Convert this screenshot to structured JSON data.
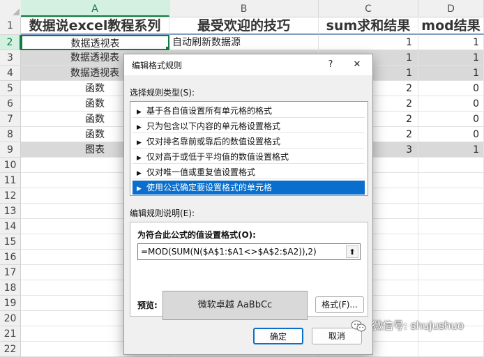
{
  "sheet": {
    "columns": [
      "A",
      "B",
      "C",
      "D"
    ],
    "row_numbers": [
      "1",
      "2",
      "3",
      "4",
      "5",
      "6",
      "7",
      "8",
      "9",
      "10",
      "11",
      "12",
      "13",
      "14",
      "15",
      "16",
      "17",
      "18",
      "19",
      "20",
      "21",
      "22"
    ],
    "header": {
      "a": "数据说excel教程系列",
      "b": "最受欢迎的技巧",
      "c": "sum求和结果",
      "d": "mod结果"
    },
    "rows": [
      {
        "a": "数据透视表",
        "b": "自动刷新数据源",
        "c": "1",
        "d": "1"
      },
      {
        "a": "数据透视表",
        "b": "",
        "c": "1",
        "d": "1"
      },
      {
        "a": "数据透视表",
        "b": "",
        "c": "1",
        "d": "1"
      },
      {
        "a": "函数",
        "b": "",
        "c": "2",
        "d": "0"
      },
      {
        "a": "函数",
        "b": "",
        "c": "2",
        "d": "0"
      },
      {
        "a": "函数",
        "b": "",
        "c": "2",
        "d": "0"
      },
      {
        "a": "函数",
        "b": "",
        "c": "2",
        "d": "0"
      },
      {
        "a": "图表",
        "b": "",
        "c": "3",
        "d": "1"
      }
    ]
  },
  "dialog": {
    "title": "编辑格式规则",
    "help_label": "?",
    "close_label": "✕",
    "rule_type_label": "选择规则类型(S):",
    "rule_types": [
      "基于各自值设置所有单元格的格式",
      "只为包含以下内容的单元格设置格式",
      "仅对排名靠前或靠后的数值设置格式",
      "仅对高于或低于平均值的数值设置格式",
      "仅对唯一值或重复值设置格式",
      "使用公式确定要设置格式的单元格"
    ],
    "selected_rule_index": 5,
    "edit_desc_label": "编辑规则说明(E):",
    "formula_label": "为符合此公式的值设置格式(O):",
    "formula_value": "=MOD(SUM(N($A$1:$A1<>$A$2:$A2)),2)",
    "preview_label": "预览:",
    "preview_text": "微软卓越  AaBbCc",
    "format_button": "格式(F)...",
    "ok_button": "确定",
    "cancel_button": "取消"
  },
  "watermark": {
    "text": "微信号: shujushuo"
  },
  "colors": {
    "accent_green": "#107c41",
    "selection_blue": "#0a6fcc",
    "row_shade": "#d9d9d9"
  }
}
